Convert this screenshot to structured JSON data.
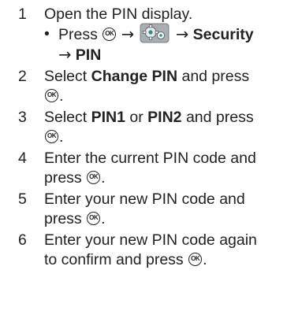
{
  "steps": [
    {
      "num": "1",
      "text": "Open the PIN display.",
      "sub": {
        "bullet": "•",
        "press": "Press",
        "key_label": "OK",
        "arrow": "→",
        "security": "Security",
        "pin": "PIN"
      }
    },
    {
      "num": "2",
      "pre": "Select ",
      "bold": "Change PIN",
      "post": " and press",
      "key_label": "OK",
      "end": "."
    },
    {
      "num": "3",
      "pre": "Select ",
      "bold1": "PIN1",
      "mid": " or ",
      "bold2": "PIN2",
      "post": " and press",
      "key_label": "OK",
      "end": "."
    },
    {
      "num": "4",
      "line1": "Enter the current PIN code and",
      "line2": "press",
      "key_label": "OK",
      "end": "."
    },
    {
      "num": "5",
      "line1": "Enter your new PIN code and",
      "line2": "press",
      "key_label": "OK",
      "end": "."
    },
    {
      "num": "6",
      "line1": "Enter your new PIN code again",
      "line2": "to confirm and press",
      "key_label": "OK",
      "end": "."
    }
  ],
  "colors": {
    "text": "#222222",
    "icon_gray": "#8a8f93",
    "icon_teal": "#2f8a8a"
  },
  "icons": {
    "key": "ok-key-icon",
    "menu": "settings-gears-icon"
  }
}
